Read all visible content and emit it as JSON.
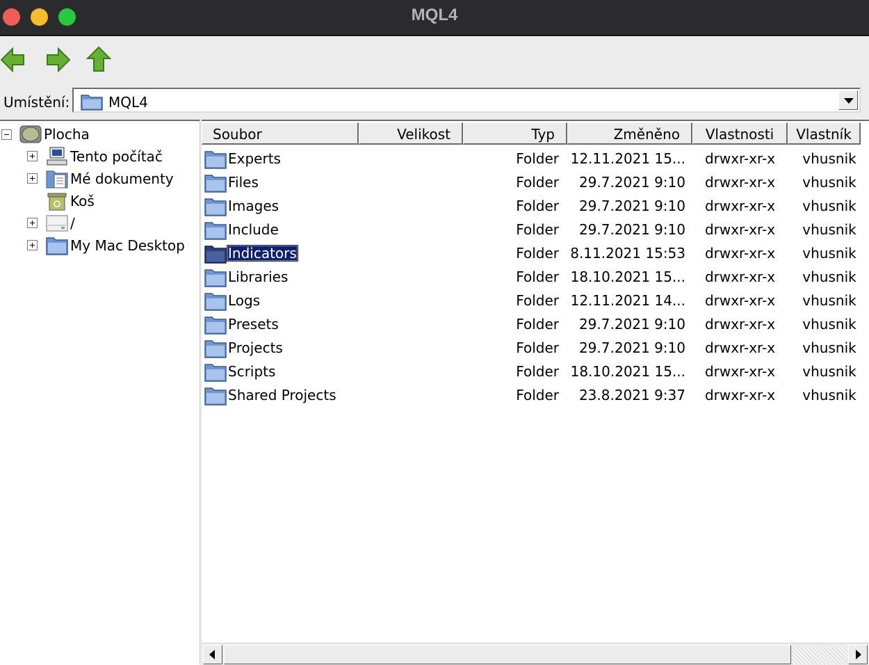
{
  "window": {
    "title": "MQL4"
  },
  "toolbar": {
    "back_icon": "arrow-left-icon",
    "forward_icon": "arrow-right-icon",
    "up_icon": "arrow-up-icon"
  },
  "location": {
    "label": "Umístění:",
    "value": "MQL4"
  },
  "tree": {
    "root": {
      "label": "Plocha",
      "icon": "desktop-globe-icon"
    },
    "items": [
      {
        "label": "Tento počítač",
        "icon": "computer-icon",
        "expandable": true
      },
      {
        "label": "Mé dokumenty",
        "icon": "documents-icon",
        "expandable": true
      },
      {
        "label": "Koš",
        "icon": "trash-icon",
        "expandable": false
      },
      {
        "label": "/",
        "icon": "drive-icon",
        "expandable": true
      },
      {
        "label": "My Mac Desktop",
        "icon": "folder-icon",
        "expandable": true
      }
    ]
  },
  "columns": {
    "name": "Soubor",
    "size": "Velikost",
    "type": "Typ",
    "modified": "Změněno",
    "attributes": "Vlastnosti",
    "owner": "Vlastník"
  },
  "files": [
    {
      "name": "Experts",
      "type": "Folder",
      "modified": "12.11.2021 15...",
      "attributes": "drwxr-xr-x",
      "owner": "vhusnik"
    },
    {
      "name": "Files",
      "type": "Folder",
      "modified": "29.7.2021 9:10",
      "attributes": "drwxr-xr-x",
      "owner": "vhusnik"
    },
    {
      "name": "Images",
      "type": "Folder",
      "modified": "29.7.2021 9:10",
      "attributes": "drwxr-xr-x",
      "owner": "vhusnik"
    },
    {
      "name": "Include",
      "type": "Folder",
      "modified": "29.7.2021 9:10",
      "attributes": "drwxr-xr-x",
      "owner": "vhusnik"
    },
    {
      "name": "Indicators",
      "type": "Folder",
      "modified": "8.11.2021 15:53",
      "attributes": "drwxr-xr-x",
      "owner": "vhusnik",
      "selected": true
    },
    {
      "name": "Libraries",
      "type": "Folder",
      "modified": "18.10.2021 15...",
      "attributes": "drwxr-xr-x",
      "owner": "vhusnik"
    },
    {
      "name": "Logs",
      "type": "Folder",
      "modified": "12.11.2021 14...",
      "attributes": "drwxr-xr-x",
      "owner": "vhusnik"
    },
    {
      "name": "Presets",
      "type": "Folder",
      "modified": "29.7.2021 9:10",
      "attributes": "drwxr-xr-x",
      "owner": "vhusnik"
    },
    {
      "name": "Projects",
      "type": "Folder",
      "modified": "29.7.2021 9:10",
      "attributes": "drwxr-xr-x",
      "owner": "vhusnik"
    },
    {
      "name": "Scripts",
      "type": "Folder",
      "modified": "18.10.2021 15...",
      "attributes": "drwxr-xr-x",
      "owner": "vhusnik"
    },
    {
      "name": "Shared Projects",
      "type": "Folder",
      "modified": "23.8.2021 9:37",
      "attributes": "drwxr-xr-x",
      "owner": "vhusnik"
    }
  ],
  "colors": {
    "selection": "#102070",
    "folder_blue": "#6f96d0",
    "nav_arrow_green": "#66b033"
  }
}
